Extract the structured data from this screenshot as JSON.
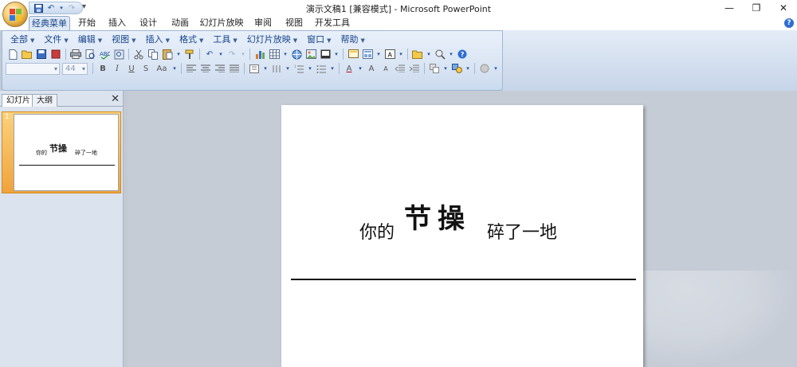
{
  "window": {
    "title": "演示文稿1 [兼容模式] - Microsoft PowerPoint",
    "minimize": "—",
    "restore": "❐",
    "close": "✕"
  },
  "qat": {
    "save": "💾",
    "undo": "↶",
    "redo": "↷",
    "more": "▾"
  },
  "tabs": [
    "经典菜单",
    "开始",
    "插入",
    "设计",
    "动画",
    "幻灯片放映",
    "审阅",
    "视图",
    "开发工具"
  ],
  "help": "?",
  "menus": [
    "全部",
    "文件",
    "编辑",
    "视图",
    "插入",
    "格式",
    "工具",
    "幻灯片放映",
    "窗口",
    "帮助"
  ],
  "combos": {
    "font_size": "44"
  },
  "panel": {
    "tabs": [
      "幻灯片",
      "大纲"
    ],
    "close": "✕",
    "slide_number": "1"
  },
  "slide": {
    "text_left": "你的",
    "text_big": "节操",
    "text_right": "碎了一地"
  },
  "colors": {
    "accent": "#15428b",
    "selection": "#f0a33c",
    "workspace": "#c6ccd6"
  }
}
